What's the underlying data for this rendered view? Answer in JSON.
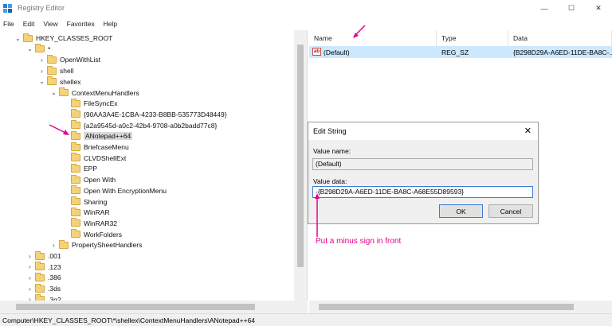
{
  "window": {
    "title": "Registry Editor",
    "min": "—",
    "max": "☐",
    "close": "✕"
  },
  "menu": [
    "File",
    "Edit",
    "View",
    "Favorites",
    "Help"
  ],
  "tree": {
    "items": [
      {
        "label": "HKEY_CLASSES_ROOT",
        "level": 0,
        "exp": "⌄"
      },
      {
        "label": "*",
        "level": 1,
        "exp": "⌄"
      },
      {
        "label": "OpenWithList",
        "level": 2,
        "exp": "›"
      },
      {
        "label": "shell",
        "level": 2,
        "exp": "›"
      },
      {
        "label": "shellex",
        "level": 2,
        "exp": "⌄"
      },
      {
        "label": "ContextMenuHandlers",
        "level": 3,
        "exp": "⌄"
      },
      {
        "label": "FileSyncEx",
        "level": 4,
        "exp": ""
      },
      {
        "label": "{90AA3A4E-1CBA-4233-B8BB-535773D48449}",
        "level": 4,
        "exp": ""
      },
      {
        "label": "{a2a9545d-a0c2-42b4-9708-a0b2badd77c8}",
        "level": 4,
        "exp": ""
      },
      {
        "label": "ANotepad++64",
        "level": 4,
        "exp": "",
        "selected": true
      },
      {
        "label": "BriefcaseMenu",
        "level": 4,
        "exp": ""
      },
      {
        "label": "CLVDShellExt",
        "level": 4,
        "exp": ""
      },
      {
        "label": "EPP",
        "level": 4,
        "exp": ""
      },
      {
        "label": "Open With",
        "level": 4,
        "exp": ""
      },
      {
        "label": "Open With EncryptionMenu",
        "level": 4,
        "exp": ""
      },
      {
        "label": "Sharing",
        "level": 4,
        "exp": ""
      },
      {
        "label": "WinRAR",
        "level": 4,
        "exp": ""
      },
      {
        "label": "WinRAR32",
        "level": 4,
        "exp": ""
      },
      {
        "label": "WorkFolders",
        "level": 4,
        "exp": ""
      },
      {
        "label": "PropertySheetHandlers",
        "level": 3,
        "exp": "›"
      },
      {
        "label": ".001",
        "level": 1,
        "exp": "›"
      },
      {
        "label": ".123",
        "level": 1,
        "exp": "›"
      },
      {
        "label": ".386",
        "level": 1,
        "exp": "›"
      },
      {
        "label": ".3ds",
        "level": 1,
        "exp": "›"
      },
      {
        "label": ".3g2",
        "level": 1,
        "exp": "›"
      }
    ]
  },
  "list": {
    "columns": [
      "Name",
      "Type",
      "Data"
    ],
    "rows": [
      {
        "name": "(Default)",
        "type": "REG_SZ",
        "data": "{B298D29A-A6ED-11DE-BA8C-..."
      }
    ]
  },
  "dialog": {
    "title": "Edit String",
    "value_name_label": "Value name:",
    "value_name": "(Default)",
    "value_data_label": "Value data:",
    "value_data": "-{B298D29A-A6ED-11DE-BA8C-A68E55D89593}",
    "ok": "OK",
    "cancel": "Cancel"
  },
  "annotation": "Put a minus sign in front",
  "status": "Computer\\HKEY_CLASSES_ROOT\\*\\shellex\\ContextMenuHandlers\\ANotepad++64",
  "colors": {
    "accent": "#e6008a",
    "selection": "#cce8ff"
  }
}
